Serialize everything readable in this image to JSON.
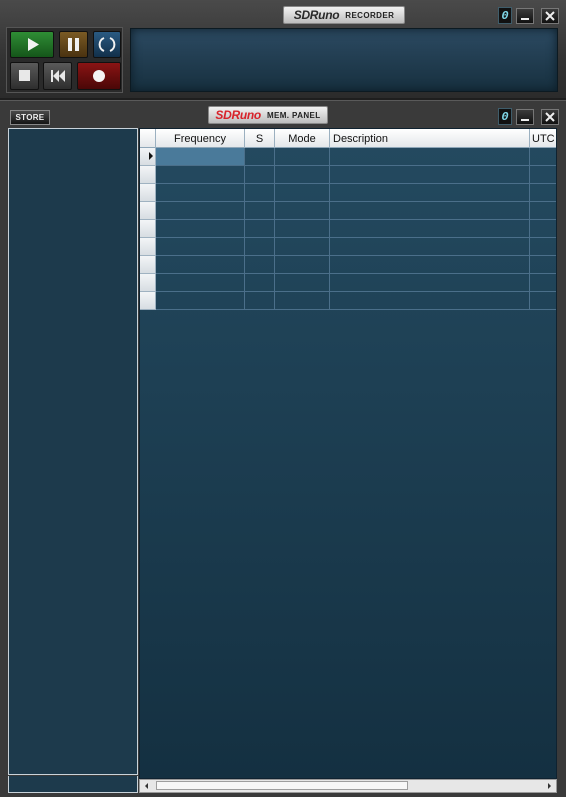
{
  "recorder": {
    "brand": "SDRuno",
    "label": "RECORDER",
    "buttons": {
      "play": "play-icon",
      "pause": "pause-icon",
      "loop": "loop-icon",
      "stop": "stop-icon",
      "rewind": "rewind-icon",
      "record": "record-icon"
    }
  },
  "mem_panel": {
    "brand": "SDRuno",
    "label": "MEM. PANEL",
    "store_label": "STORE",
    "columns": [
      "Frequency",
      "S",
      "Mode",
      "Description",
      "UTC"
    ],
    "empty_row_count": 9,
    "selected_row": 0
  },
  "window_controls": {
    "counter": "0",
    "minimize": "minimize-icon",
    "close": "close-icon"
  },
  "colors": {
    "play_green": "#1d6b22",
    "pause_amber": "#5a3e16",
    "loop_blue": "#1a3e5e",
    "record_red": "#6e0b0b",
    "panel_blue": "#1d3a4c",
    "accent_red": "#d8232a",
    "selected_cell": "#4a7a9a"
  }
}
